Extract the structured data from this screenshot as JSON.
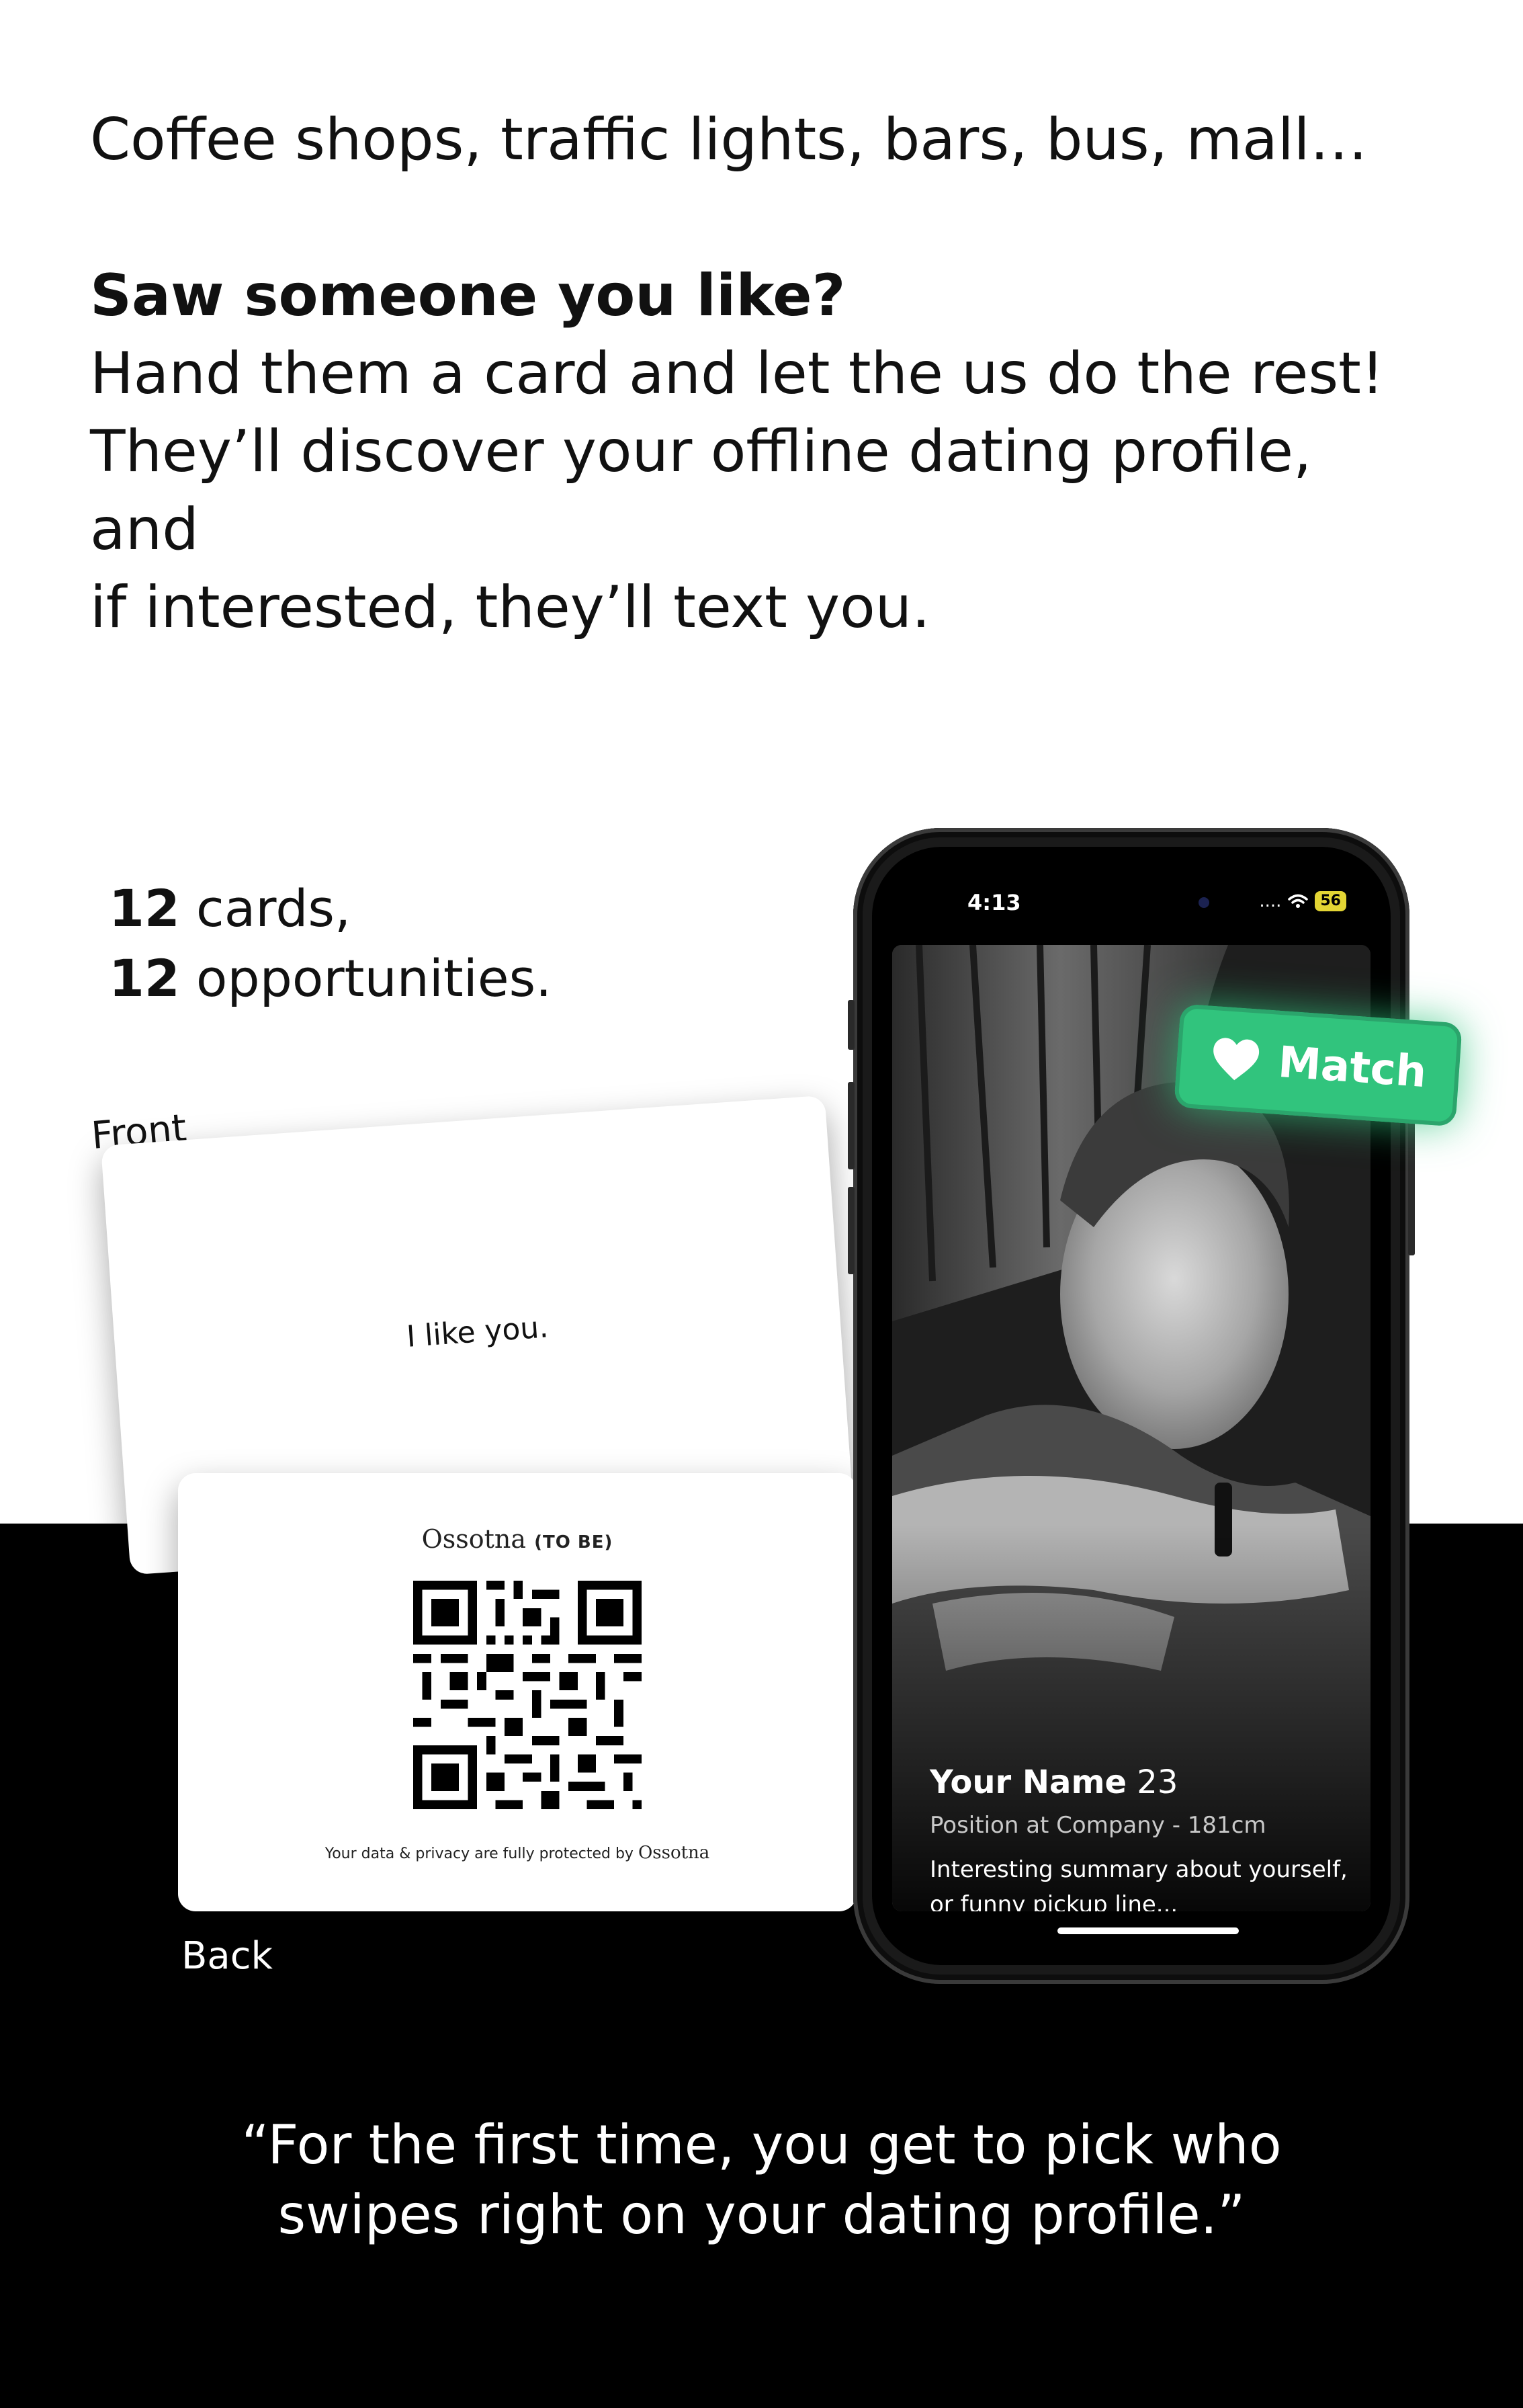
{
  "intro": {
    "line1": "Coffee shops, traffic lights, bars, bus, mall…",
    "question": "Saw someone you like?",
    "line3": "Hand them a card and let the us do the rest!",
    "line4": "They’ll discover your offline dating profile, and",
    "line5": "if interested, they’ll text you."
  },
  "cards_heading": {
    "count1": "12",
    "text1": " cards,",
    "count2": "12",
    "text2": " opportunities."
  },
  "front_card": {
    "label": "Front",
    "text": "I like you."
  },
  "back_card": {
    "label": "Back",
    "brand": "Ossotna",
    "brand_sub": "(TO BE)",
    "privacy": "Your data & privacy are fully protected by ",
    "privacy_brand": "Ossotna"
  },
  "phone": {
    "time": "4:13",
    "signal": "....",
    "battery": "56",
    "name": "Your Name",
    "age": "23",
    "position": "Position at Company - 181cm",
    "bio": "Interesting summary about yourself, or funny pickup line...",
    "photo_icon": "profile-photo",
    "wifi_icon": "wifi-icon"
  },
  "match_badge": {
    "label": "Match",
    "icon": "heart-icon",
    "color": "#31c47d"
  },
  "quote": {
    "line1": "“For the first time, you get to pick who",
    "line2": "swipes right on your dating profile.”"
  }
}
